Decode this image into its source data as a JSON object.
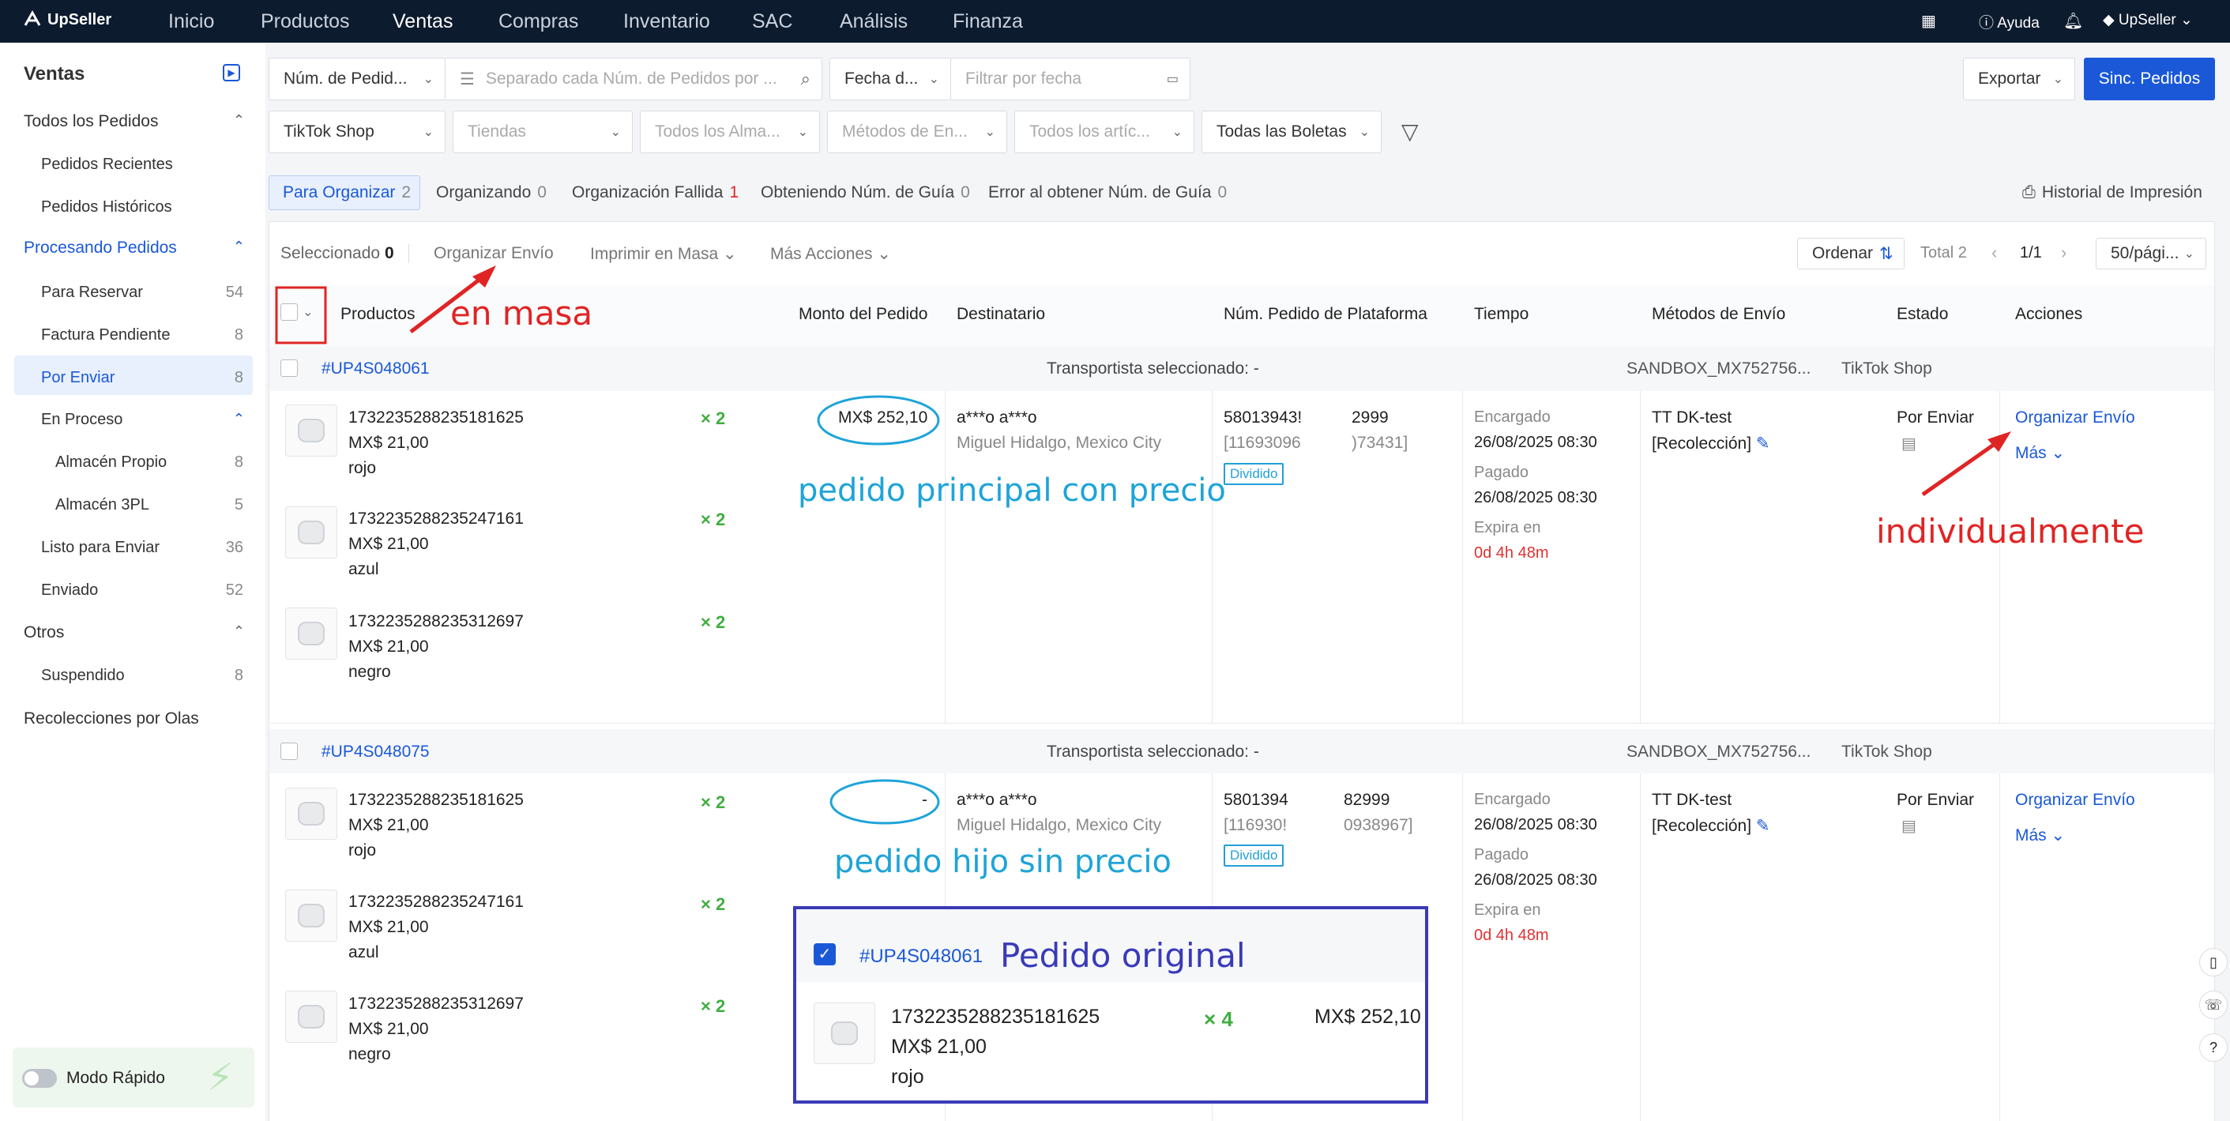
{
  "topbar": {
    "brand": "UpSeller",
    "nav": [
      "Inicio",
      "Productos",
      "Ventas",
      "Compras",
      "Inventario",
      "SAC",
      "Análisis",
      "Finanza"
    ],
    "help": "Ayuda",
    "user": "UpSeller"
  },
  "sidebar": {
    "title": "Ventas",
    "groups": [
      {
        "label": "Todos los Pedidos",
        "items": [
          {
            "label": "Pedidos Recientes",
            "count": ""
          },
          {
            "label": "Pedidos Históricos",
            "count": ""
          }
        ]
      },
      {
        "label": "Procesando Pedidos",
        "items": [
          {
            "label": "Para Reservar",
            "count": "54"
          },
          {
            "label": "Factura Pendiente",
            "count": "8"
          },
          {
            "label": "Por Enviar",
            "count": "8"
          },
          {
            "label": "En Proceso",
            "count": ""
          },
          {
            "label": "Almacén Propio",
            "count": "8"
          },
          {
            "label": "Almacén 3PL",
            "count": "5"
          },
          {
            "label": "Listo para Enviar",
            "count": "36"
          },
          {
            "label": "Enviado",
            "count": "52"
          }
        ]
      },
      {
        "label": "Otros",
        "items": [
          {
            "label": "Suspendido",
            "count": "8"
          }
        ]
      },
      {
        "label": "Recolecciones por Olas",
        "items": []
      }
    ],
    "quick_mode": "Modo Rápido"
  },
  "filters": {
    "order_num_type": "Núm. de Pedid...",
    "order_search_placeholder": "Separado cada Núm. de Pedidos por ...",
    "date_type": "Fecha d...",
    "date_placeholder": "Filtrar por fecha",
    "platform": "TikTok Shop",
    "stores": "Tiendas",
    "warehouses": "Todos los Alma...",
    "shipping": "Métodos de En...",
    "articles": "Todos los artíc...",
    "receipts": "Todas las Boletas",
    "export": "Exportar",
    "sync": "Sinc. Pedidos"
  },
  "tabs": [
    {
      "label": "Para Organizar",
      "count": "2"
    },
    {
      "label": "Organizando",
      "count": "0"
    },
    {
      "label": "Organización Fallida",
      "count": "1"
    },
    {
      "label": "Obteniendo Núm. de Guía",
      "count": "0"
    },
    {
      "label": "Error al obtener Núm. de Guía",
      "count": "0"
    }
  ],
  "print_history": "Historial de Impresión",
  "toolbar": {
    "selected_label": "Seleccionado",
    "selected_count": "0",
    "organize": "Organizar Envío",
    "bulk_print": "Imprimir en Masa",
    "more": "Más Acciones",
    "sort": "Ordenar",
    "total": "Total 2",
    "page": "1/1",
    "per_page": "50/pági..."
  },
  "columns": [
    "Productos",
    "Monto del Pedido",
    "Destinatario",
    "Núm. Pedido de Plataforma",
    "Tiempo",
    "Métodos de Envío",
    "Estado",
    "Acciones"
  ],
  "orders": [
    {
      "id": "#UP4S048061",
      "carrier": "Transportista seleccionado: -",
      "sandbox": "SANDBOX_MX752756...",
      "shop": "TikTok Shop",
      "amount": "MX$ 252,10",
      "recipient": "a***o a***o",
      "location": "Miguel Hidalgo, Mexico City",
      "platform_num_a": "58013943!",
      "platform_num_b": "2999",
      "platform_sub_a": "[11693096",
      "platform_sub_b": ")73431]",
      "split": "Dividido",
      "ordered_label": "Encargado",
      "ordered": "26/08/2025 08:30",
      "paid_label": "Pagado",
      "paid": "26/08/2025 08:30",
      "expires_label": "Expira en",
      "expires": "0d 4h 48m",
      "ship_method": "TT DK-test",
      "ship_sub": "[Recolección]",
      "status": "Por Enviar",
      "action": "Organizar Envío",
      "more": "Más",
      "items": [
        {
          "sku": "1732235288235181625",
          "price": "MX$ 21,00",
          "variant": "rojo",
          "qty": "× 2"
        },
        {
          "sku": "1732235288235247161",
          "price": "MX$ 21,00",
          "variant": "azul",
          "qty": "× 2"
        },
        {
          "sku": "1732235288235312697",
          "price": "MX$ 21,00",
          "variant": "negro",
          "qty": "× 2"
        }
      ]
    },
    {
      "id": "#UP4S048075",
      "carrier": "Transportista seleccionado: -",
      "sandbox": "SANDBOX_MX752756...",
      "shop": "TikTok Shop",
      "amount": "-",
      "recipient": "a***o a***o",
      "location": "Miguel Hidalgo, Mexico City",
      "platform_num_a": "5801394",
      "platform_num_b": "82999",
      "platform_sub_a": "[116930!",
      "platform_sub_b": "0938967]",
      "split": "Dividido",
      "ordered_label": "Encargado",
      "ordered": "26/08/2025 08:30",
      "paid_label": "Pagado",
      "paid": "26/08/2025 08:30",
      "expires_label": "Expira en",
      "expires": "0d 4h 48m",
      "ship_method": "TT DK-test",
      "ship_sub": "[Recolección]",
      "status": "Por Enviar",
      "action": "Organizar Envío",
      "more": "Más",
      "items": [
        {
          "sku": "1732235288235181625",
          "price": "MX$ 21,00",
          "variant": "rojo",
          "qty": "× 2"
        },
        {
          "sku": "1732235288235247161",
          "price": "MX$ 21,00",
          "variant": "azul",
          "qty": "× 2"
        },
        {
          "sku": "1732235288235312697",
          "price": "MX$ 21,00",
          "variant": "negro",
          "qty": "× 2"
        }
      ]
    }
  ],
  "callout": {
    "id": "#UP4S048061",
    "title": "Pedido original",
    "sku": "1732235288235181625",
    "price": "MX$ 21,00",
    "variant": "rojo",
    "qty": "× 4",
    "amount": "MX$ 252,10"
  },
  "annotations": {
    "bulk": "en masa",
    "individual": "individualmente",
    "main_order": "pedido principal con precio",
    "child_order": "pedido hijo sin precio"
  },
  "colors": {
    "topbar": "#0d1b2e",
    "primary": "#1a58d8",
    "annotation_red": "#e02424",
    "annotation_cyan": "#1ea4d8",
    "annotation_navy": "#3a3ab8"
  }
}
